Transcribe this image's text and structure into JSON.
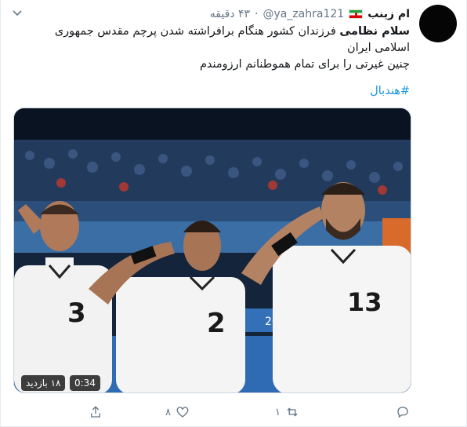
{
  "tweet": {
    "author_name": "ام زینب",
    "flag_icon": "iran-flag-icon",
    "handle": "@ya_zahra121",
    "separator": "·",
    "time": "۴۳ دقیقه",
    "text_bold": "سلام نظامی",
    "text_line1": " فرزندان کشور هنگام برافراشته شدن پرچم مقدس جمهوری اسلامی ایران",
    "text_line2": "چنین غیرتی را برای تمام هموطنانم ارزومندم",
    "hashtag": "#هندبال"
  },
  "media": {
    "type": "video",
    "views": "۱۸ بازدید",
    "duration": "0:34",
    "jersey_numbers": [
      "3",
      "2",
      "13"
    ],
    "board_text": "2020"
  },
  "actions": {
    "reply_count": "",
    "retweet_count": "۱",
    "like_count": "۸",
    "share_count": ""
  },
  "colors": {
    "link": "#1b95e0",
    "muted": "#657786",
    "text": "#14171a"
  }
}
